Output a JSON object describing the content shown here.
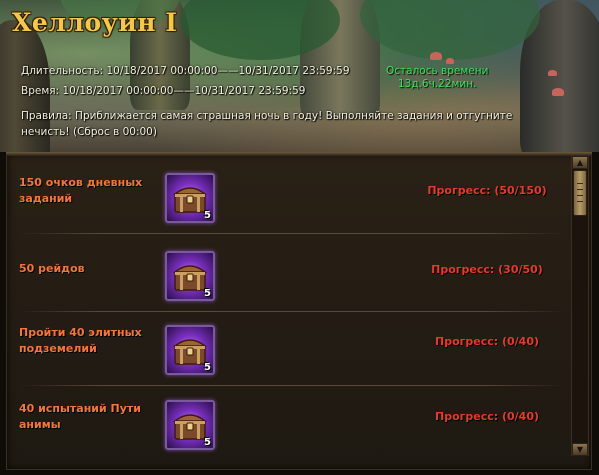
{
  "event": {
    "title": "Хеллоуин I",
    "duration_label": "Длительность:",
    "duration_value": "10/18/2017 00:00:00——10/31/2017 23:59:59",
    "time_label": "Время:",
    "time_value": "10/18/2017 00:00:00——10/31/2017 23:59:59",
    "remaining_label": "Осталось времени",
    "remaining_value": "13д.6ч.22мин.",
    "rules_label": "Правила:",
    "rules_text": "Приближается самая страшная ночь в году! Выполняйте задания и отгугните нечисть! (Сброс в 00:00)"
  },
  "colors": {
    "title": "#f3c84a",
    "task_label": "#f3773c",
    "progress": "#e43b2a",
    "remaining": "#3ee05a",
    "reward_glow": "#7a2fc0"
  },
  "tasks": [
    {
      "label": "150 очков дневных заданий",
      "reward_icon": "treasure-chest-icon",
      "reward_qty": "5",
      "progress": "Прогресс:  (50/150)"
    },
    {
      "label": "50 рейдов",
      "reward_icon": "treasure-chest-icon",
      "reward_qty": "5",
      "progress": "Прогресс:  (30/50)"
    },
    {
      "label": "Пройти 40 элитных подземелий",
      "reward_icon": "treasure-chest-icon",
      "reward_qty": "5",
      "progress": "Прогресс:  (0/40)"
    },
    {
      "label": "40 испытаний Пути анимы",
      "reward_icon": "treasure-chest-icon",
      "reward_qty": "5",
      "progress": "Прогресс:  (0/40)"
    }
  ],
  "scrollbar": {
    "up_icon": "arrow-up-icon",
    "down_icon": "arrow-down-icon"
  }
}
